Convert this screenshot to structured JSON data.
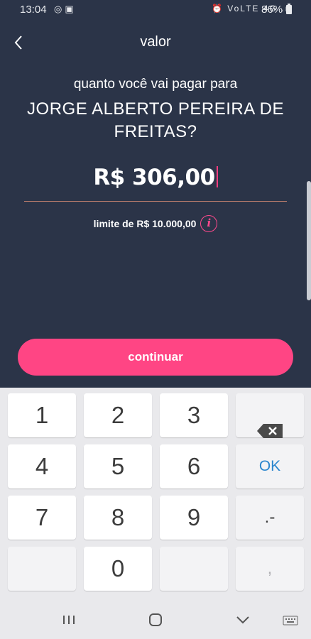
{
  "status_bar": {
    "time": "13:04",
    "left_icons": [
      "sync-icon",
      "image-icon"
    ],
    "right_icons": [
      "alarm-icon",
      "volte-icon",
      "4g-icon",
      "signal-icon"
    ],
    "right_icons_text": "⏰ VoLTE 4G .ıl",
    "battery": "86%"
  },
  "header": {
    "title": "valor",
    "back_icon": "chevron-left-icon"
  },
  "payment": {
    "question": "quanto você vai pagar para",
    "recipient": "JORGE ALBERTO PEREIRA DE FREITAS?",
    "amount": "R$ 306,00",
    "limit": "limite de R$ 10.000,00",
    "info_icon_label": "i"
  },
  "actions": {
    "continue_label": "continuar"
  },
  "keyboard": {
    "keys": [
      "1",
      "2",
      "3",
      "4",
      "5",
      "6",
      "OK",
      "7",
      "8",
      "9",
      ".-",
      "0",
      ","
    ]
  },
  "nav_bar": {
    "items": [
      "recent-apps-icon",
      "home-icon",
      "back-chevron-icon",
      "keyboard-icon"
    ]
  },
  "colors": {
    "background": "#2b3448",
    "accent": "#ff4584",
    "ok_key": "#2b86ce"
  }
}
